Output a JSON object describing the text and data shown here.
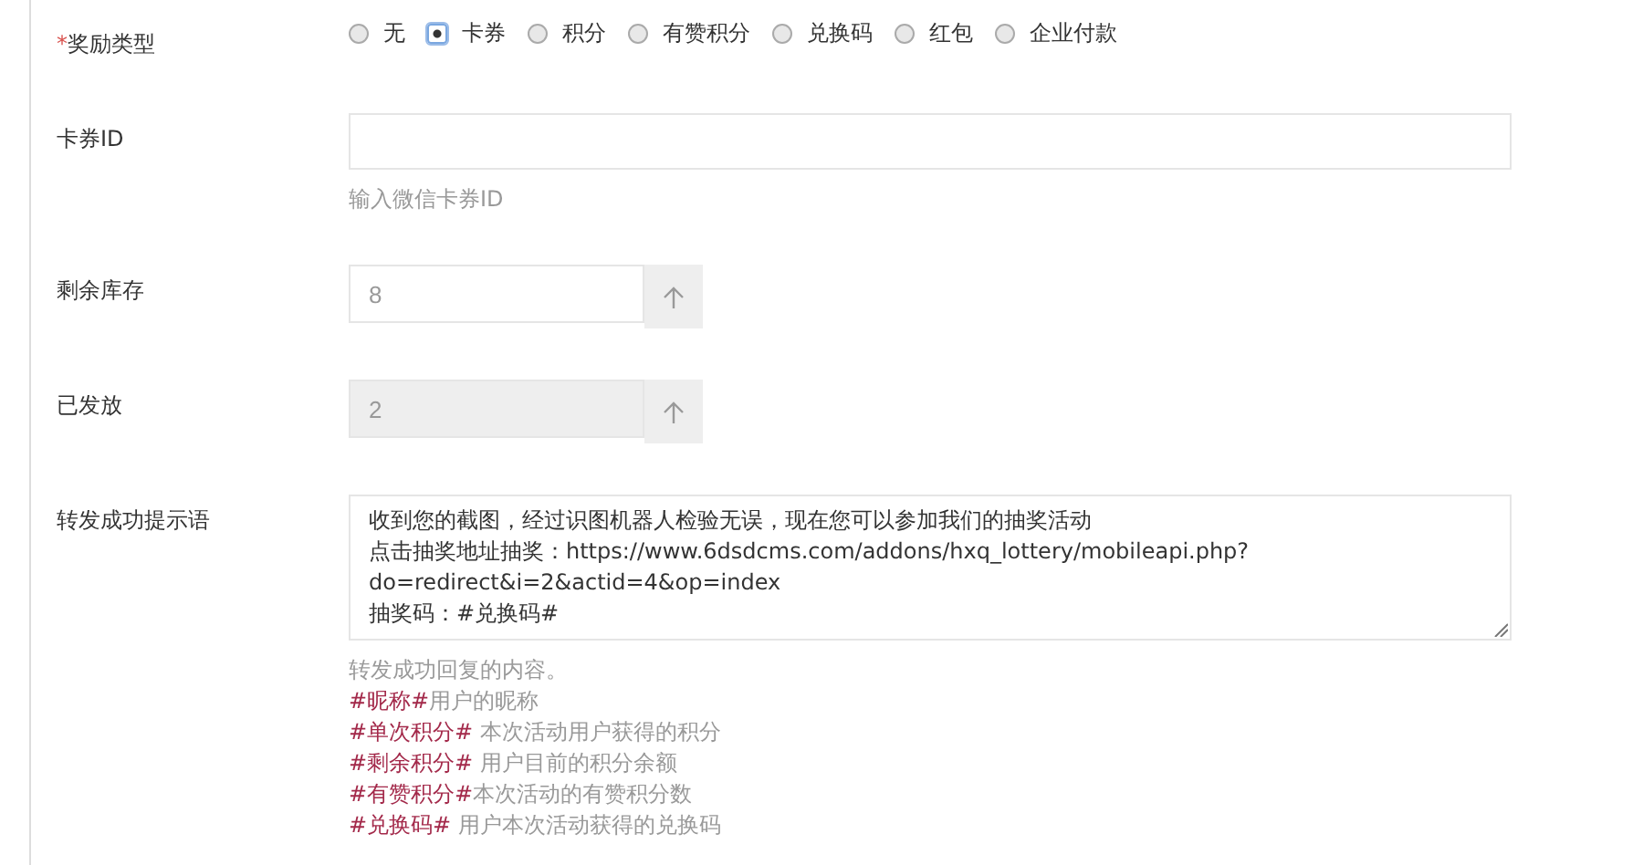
{
  "reward_type": {
    "label": "奖励类型",
    "required_mark": "*",
    "options": [
      {
        "label": "无",
        "selected": false
      },
      {
        "label": "卡券",
        "selected": true
      },
      {
        "label": "积分",
        "selected": false
      },
      {
        "label": "有赞积分",
        "selected": false
      },
      {
        "label": "兑换码",
        "selected": false
      },
      {
        "label": "红包",
        "selected": false
      },
      {
        "label": "企业付款",
        "selected": false
      }
    ]
  },
  "card_id": {
    "label": "卡券ID",
    "hint": "输入微信卡券ID"
  },
  "stock": {
    "label": "剩余库存",
    "value": "8",
    "disabled": false
  },
  "issued": {
    "label": "已发放",
    "value": "2",
    "disabled": true
  },
  "forward_message": {
    "label": "转发成功提示语",
    "lines": [
      "收到您的截图，经过识图机器人检验无误，现在您可以参加我们的抽奖活动",
      "点击抽奖地址抽奖：https://www.6dsdcms.com/addons/hxq_lottery/mobileapi.php?",
      "do=redirect&i=2&actid=4&op=index",
      "抽奖码：#兑换码#"
    ],
    "hint": "转发成功回复的内容。",
    "variables": [
      {
        "tag": "#昵称#",
        "text": "用户的昵称"
      },
      {
        "tag": "#单次积分#",
        "text": " 本次活动用户获得的积分"
      },
      {
        "tag": "#剩余积分#",
        "text": " 用户目前的积分余额"
      },
      {
        "tag": "#有赞积分#",
        "text": "本次活动的有赞积分数"
      },
      {
        "tag": "#兑换码#",
        "text": " 用户本次活动获得的兑换码"
      }
    ]
  }
}
